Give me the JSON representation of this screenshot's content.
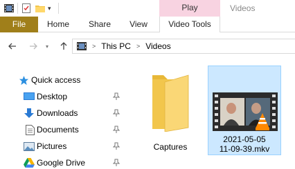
{
  "window": {
    "title": "Videos"
  },
  "ribbon": {
    "context_group": "Play",
    "tabs": [
      "File",
      "Home",
      "Share",
      "View",
      "Video Tools"
    ],
    "colors": {
      "file_tab": "#a07f1a",
      "context_group": "#f8d3e1"
    }
  },
  "address": {
    "crumbs": [
      "This PC",
      "Videos"
    ]
  },
  "navigation": {
    "quick_access": "Quick access",
    "items": [
      {
        "label": "Desktop",
        "icon": "desktop-icon",
        "pinned": true
      },
      {
        "label": "Downloads",
        "icon": "download-icon",
        "pinned": true
      },
      {
        "label": "Documents",
        "icon": "documents-icon",
        "pinned": true
      },
      {
        "label": "Pictures",
        "icon": "pictures-icon",
        "pinned": true
      },
      {
        "label": "Google Drive",
        "icon": "google-drive-icon",
        "pinned": true
      }
    ]
  },
  "files": [
    {
      "name": "Captures",
      "type": "folder",
      "selected": false
    },
    {
      "name_line1": "2021-05-05",
      "name_line2": "11-09-39.mkv",
      "type": "video",
      "selected": true
    }
  ]
}
